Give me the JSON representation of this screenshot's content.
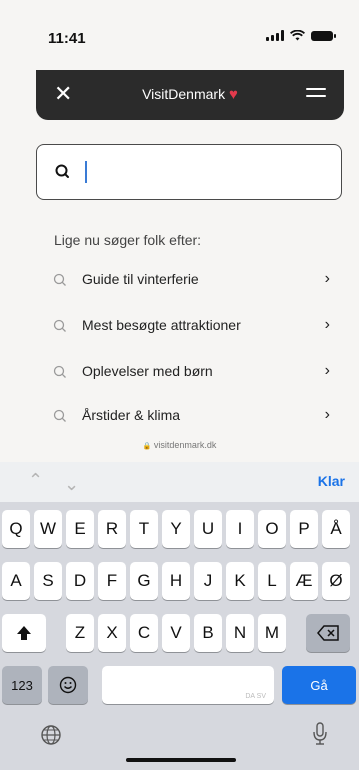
{
  "status": {
    "time": "11:41"
  },
  "header": {
    "brand": "VisitDenmark",
    "brand_heart": "♥"
  },
  "search": {
    "placeholder": "",
    "value": ""
  },
  "suggestions": {
    "title": "Lige nu søger folk efter:",
    "items": [
      {
        "label": "Guide til vinterferie"
      },
      {
        "label": "Mest besøgte attraktioner"
      },
      {
        "label": "Oplevelser med børn"
      },
      {
        "label": "Årstider & klima"
      }
    ]
  },
  "url": {
    "text": "visitdenmark.dk",
    "lock": "🔒"
  },
  "keyboard": {
    "done_label": "Klar",
    "row1": [
      "Q",
      "W",
      "E",
      "R",
      "T",
      "Y",
      "U",
      "I",
      "O",
      "P",
      "Å"
    ],
    "row2": [
      "A",
      "S",
      "D",
      "F",
      "G",
      "H",
      "J",
      "K",
      "L",
      "Æ",
      "Ø"
    ],
    "row3": [
      "Z",
      "X",
      "C",
      "V",
      "B",
      "N",
      "M"
    ],
    "numbers_label": "123",
    "go_label": "Gå",
    "space_hint": "DA SV"
  },
  "colors": {
    "accent": "#1a73e8",
    "header_bg": "#2b2b2b",
    "heart": "#e33a4c"
  }
}
